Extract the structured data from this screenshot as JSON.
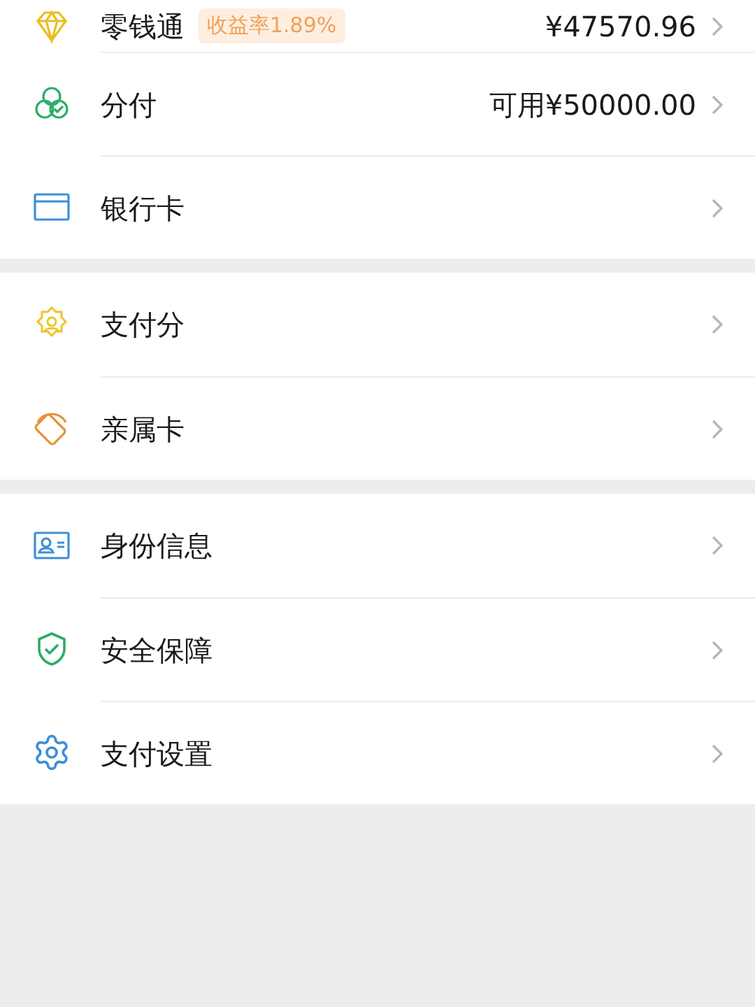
{
  "sections": [
    {
      "items": [
        {
          "kind": "diamond",
          "label": "零钱通",
          "badge": "收益率1.89%",
          "value": "¥47570.96"
        },
        {
          "kind": "circles",
          "label": "分付",
          "value": "可用¥50000.00"
        },
        {
          "kind": "card",
          "label": "银行卡"
        }
      ]
    },
    {
      "items": [
        {
          "kind": "badge",
          "label": "支付分"
        },
        {
          "kind": "family",
          "label": "亲属卡"
        }
      ]
    },
    {
      "items": [
        {
          "kind": "id",
          "label": "身份信息"
        },
        {
          "kind": "shield",
          "label": "安全保障"
        },
        {
          "kind": "gear",
          "label": "支付设置"
        }
      ]
    }
  ]
}
